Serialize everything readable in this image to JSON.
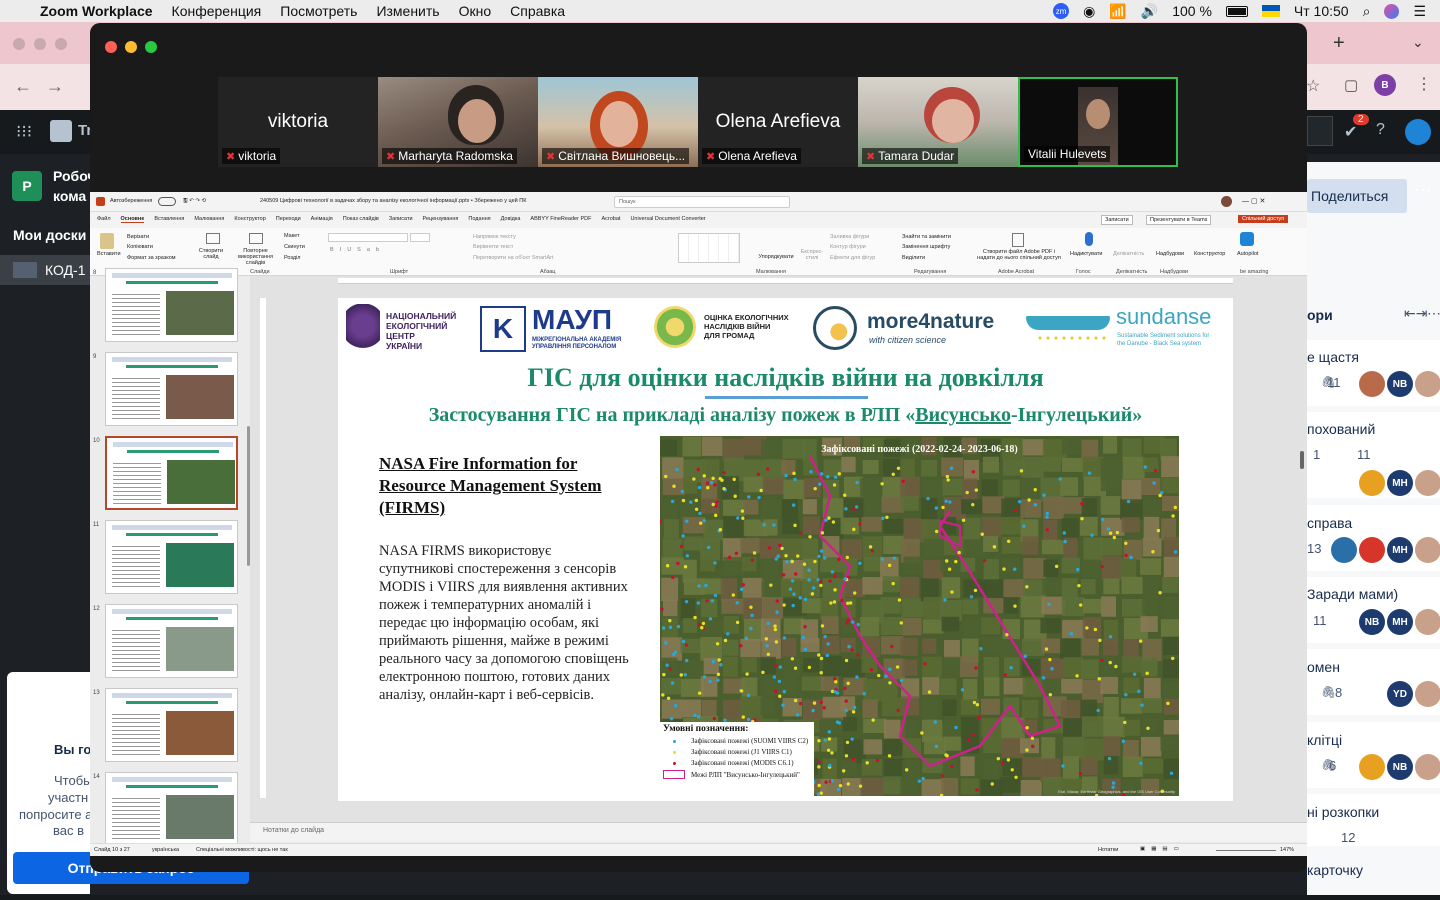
{
  "menubar": {
    "app": "Zoom Workplace",
    "items": [
      "Конференция",
      "Посмотреть",
      "Изменить",
      "Окно",
      "Справка"
    ],
    "battery": "100 %",
    "clock": "Чт 10:50"
  },
  "browser": {
    "sidebar": {
      "workspace_short": "P",
      "workspace_line1": "Робоч",
      "workspace_line2": "кома",
      "boards_title": "Мои доски",
      "board_item": "КОД-1"
    },
    "topbar": {
      "partial_label": "Tr",
      "notif_count": "2",
      "avatar": "B"
    },
    "right_panel": {
      "share_button": "Поделиться",
      "heading": "ори",
      "cards": [
        {
          "title": "е щастя",
          "count1": "11",
          "avatars": [
            "",
            "NB",
            ""
          ]
        },
        {
          "title": "похований",
          "count1": "1",
          "count2": "11",
          "avatars": [
            "",
            "MH",
            ""
          ]
        },
        {
          "title": "справа",
          "count1": "13",
          "avatars": [
            "",
            "",
            "MH",
            ""
          ]
        },
        {
          "title": "Заради мами)",
          "count1": "11",
          "avatars": [
            "NB",
            "MH",
            ""
          ]
        },
        {
          "title": "омен",
          "count1": "8",
          "avatars": [
            "YD",
            ""
          ]
        },
        {
          "title": "клітці",
          "count1": "6",
          "avatars": [
            "",
            "NB",
            ""
          ]
        },
        {
          "title": "ні розкопки",
          "count1": "12",
          "avatars": []
        }
      ],
      "add_card": "карточку"
    },
    "dialog": {
      "title_partial": "Вы го",
      "line1": "Чтобы",
      "line2": "участн",
      "line3": "попросите а",
      "line4": "вас в",
      "button": "Отправить запрос"
    }
  },
  "zoom": {
    "participants": [
      {
        "name": "viktoria",
        "big_name": "viktoria",
        "video": false
      },
      {
        "name": "Marharyta Radomska",
        "big_name": "",
        "video": true
      },
      {
        "name": "Світлана Вишновець...",
        "big_name": "",
        "video": true
      },
      {
        "name": "Olena Arefieva",
        "big_name": "Olena Arefieva",
        "video": false
      },
      {
        "name": "Tamara Dudar",
        "big_name": "",
        "video": true
      },
      {
        "name": "Vitalii Hulevets",
        "big_name": "",
        "video": true,
        "active": true
      }
    ]
  },
  "ppt": {
    "autosave": "Автозбереження",
    "file_title": "240509 Цифрові технології в задачах збору та аналізу екологічної інформації.pptx • Збережено у цей ПК",
    "search": "Пошук",
    "tabs": [
      "Файл",
      "Основне",
      "Вставлення",
      "Малювання",
      "Конструктор",
      "Переходи",
      "Анімація",
      "Показ слайдів",
      "Записати",
      "Рецензування",
      "Подання",
      "Довідка",
      "ABBYY FineReader PDF",
      "Acrobat",
      "Universal Document Converter"
    ],
    "active_tab": "Основне",
    "btn_record": "Записати",
    "btn_present_teams": "Презентувати в Teams",
    "btn_share": "Спільний доступ",
    "ribbon_groups": [
      "Буфер обміну",
      "Слайди",
      "Шрифт",
      "Абзац",
      "Малювання",
      "Редагування",
      "Adobe Acrobat",
      "Голос",
      "Делікатність",
      "Надбудови",
      "be amazing"
    ],
    "ribbon_buttons": {
      "paste": "Вставити",
      "cut": "Вирізати",
      "copy": "Копіювати",
      "format": "Формат за зразком",
      "new_slide": "Створити слайд",
      "reuse": "Повторне використання слайдів",
      "layout": "Макет",
      "reset": "Скинути",
      "section": "Розділ",
      "arrange": "Упорядкувати",
      "quick_styles": "Експрес-стилі",
      "find": "Знайти та замінити",
      "replace_font": "Замінення шрифту",
      "select": "Виділити",
      "acrobat": "Створити файл Adobe PDF і надати до нього спільний доступ",
      "dictate": "Надиктувати",
      "sensitivity": "Делікатність",
      "addins": "Надбудови",
      "designer": "Конструктор",
      "autopilot": "Autopilot",
      "text_direction": "Напрямок тексту",
      "align_text": "Вирівняти текст",
      "smartart": "Перетворити на об'єкт SmartArt",
      "shape_fill": "Заливка фігури",
      "shape_outline": "Контур фігури",
      "shape_effects": "Ефекти для фігур"
    },
    "slide_numbers": [
      "8",
      "9",
      "10",
      "11",
      "12",
      "13",
      "14"
    ],
    "selected_slide": "10",
    "notes_placeholder": "Нотатки до слайда",
    "status": {
      "slide_pos": "Слайд 10 з 27",
      "language": "українська",
      "accessibility": "Спеціальні можливості: щось не так",
      "notes_btn": "Нотатки",
      "zoom": "147%"
    },
    "slide": {
      "logo1": [
        "НАЦІОНАЛЬНИЙ",
        "ЕКОЛОГІЧНИЙ",
        "ЦЕНТР",
        "УКРАЇНИ"
      ],
      "logo2_big": "МАУП",
      "logo2_small": [
        "МІЖРЕГІОНАЛЬНА АКАДЕМІЯ",
        "УПРАВЛІННЯ ПЕРСОНАЛОМ"
      ],
      "logo3": [
        "ОЦІНКА ЕКОЛОГІЧНИХ",
        "НАСЛІДКІВ ВІЙНИ",
        "ДЛЯ ГРОМАД"
      ],
      "logo4_main": "more4nature",
      "logo4_sub": "with citizen science",
      "logo5_main": "sundanse",
      "logo5_sub": [
        "Sustainable Sediment solutions for",
        "the Danube - Black Sea system"
      ],
      "title": "ГІС для оцінки наслідків війни на довкілля",
      "subtitle_prefix": "Застосування ГІС на прикладі аналізу пожеж в РЛП «",
      "subtitle_underlined": "Висунсько",
      "subtitle_suffix": "-Інгулецький»",
      "heading": "NASA Fire Information for Resource Management System (FIRMS)",
      "paragraph": "NASA FIRMS використовує супутникові спостереження з сенсорів MODIS і VIIRS для виявлення активних пожеж і температурних аномалій і передає цю інформацію особам, які приймають рішення, майже в режимі реального часу за допомогою сповіщень електронною поштою, готових даних аналізу, онлайн-карт і веб-сервісів.",
      "map_title": "Зафіксовані пожежі (2022-02-24- 2023-06-18)",
      "legend_title": "Умовні позначення:",
      "legend": [
        {
          "label": "Зафіксовані пожежі (SUOMI VIIRS C2)",
          "color": "#2aa8d8"
        },
        {
          "label": "Зафіксовані пожежі (J1 VIIRS C1)",
          "color": "#e8e020"
        },
        {
          "label": "Зафіксовані пожежі (MODIS C6.1)",
          "color": "#c8102e"
        },
        {
          "label": "Межі РЛП \"Висунсько-Інгулецький\"",
          "color": "#d0208c"
        }
      ],
      "map_credit": "Esri, Maxar, Earthstar Geographics, and the GIS User Community"
    }
  }
}
